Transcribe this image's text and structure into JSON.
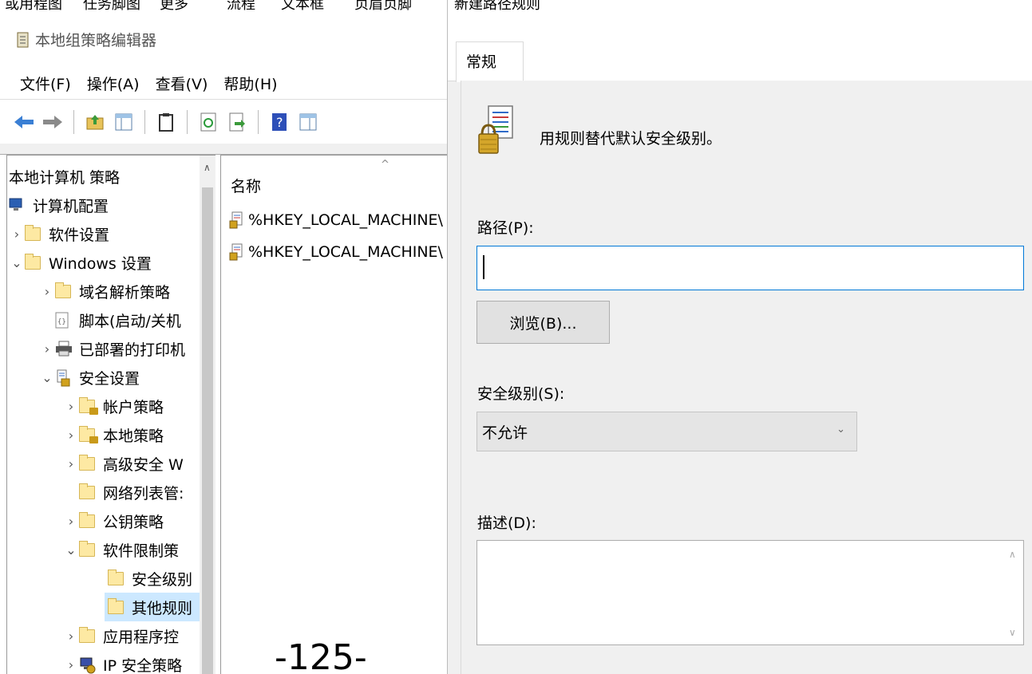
{
  "top_strip": {
    "left_fragments": [
      "或用程图",
      "任务脚图",
      "更多"
    ],
    "mid_fragments": [
      "流程",
      "文本框",
      "页眉页脚"
    ]
  },
  "mmc": {
    "title": "本地组策略编辑器",
    "menu": [
      "文件(F)",
      "操作(A)",
      "查看(V)",
      "帮助(H)"
    ],
    "tree": {
      "root": "本地计算机 策略",
      "items": [
        {
          "label": "计算机配置",
          "twisty": "",
          "icon": "computer-icon"
        },
        {
          "label": "软件设置",
          "twisty": "›",
          "icon": "folder-icon"
        },
        {
          "label": "Windows 设置",
          "twisty": "⌄",
          "icon": "folder-icon"
        },
        {
          "label": "域名解析策略",
          "twisty": "›",
          "icon": "folder-icon"
        },
        {
          "label": "脚本(启动/关机",
          "twisty": "",
          "icon": "script-icon"
        },
        {
          "label": "已部署的打印机",
          "twisty": "›",
          "icon": "printer-icon"
        },
        {
          "label": "安全设置",
          "twisty": "⌄",
          "icon": "security-icon"
        },
        {
          "label": "帐户策略",
          "twisty": "›",
          "icon": "locked-folder-icon"
        },
        {
          "label": "本地策略",
          "twisty": "›",
          "icon": "locked-folder-icon"
        },
        {
          "label": "高级安全 W",
          "twisty": "›",
          "icon": "folder-icon"
        },
        {
          "label": "网络列表管:",
          "twisty": "",
          "icon": "folder-icon"
        },
        {
          "label": "公钥策略",
          "twisty": "›",
          "icon": "folder-icon"
        },
        {
          "label": "软件限制策",
          "twisty": "⌄",
          "icon": "folder-icon"
        },
        {
          "label": "安全级别",
          "twisty": "",
          "icon": "folder-icon"
        },
        {
          "label": "其他规则",
          "twisty": "",
          "icon": "folder-icon"
        },
        {
          "label": "应用程序控",
          "twisty": "›",
          "icon": "folder-icon"
        },
        {
          "label": "IP 安全策略",
          "twisty": "›",
          "icon": "ip-security-icon"
        }
      ]
    },
    "list": {
      "header": "名称",
      "rows": [
        "%HKEY_LOCAL_MACHINE\\",
        "%HKEY_LOCAL_MACHINE\\"
      ]
    },
    "page_number": "-125-"
  },
  "dialog": {
    "title": "新建路径规则",
    "tab": "常规",
    "intro": "用规则替代默认安全级别。",
    "path_label": "路径(P):",
    "path_value": "",
    "browse_label": "浏览(B)...",
    "security_label": "安全级别(S):",
    "security_value": "不允许",
    "desc_label": "描述(D):",
    "desc_value": ""
  }
}
